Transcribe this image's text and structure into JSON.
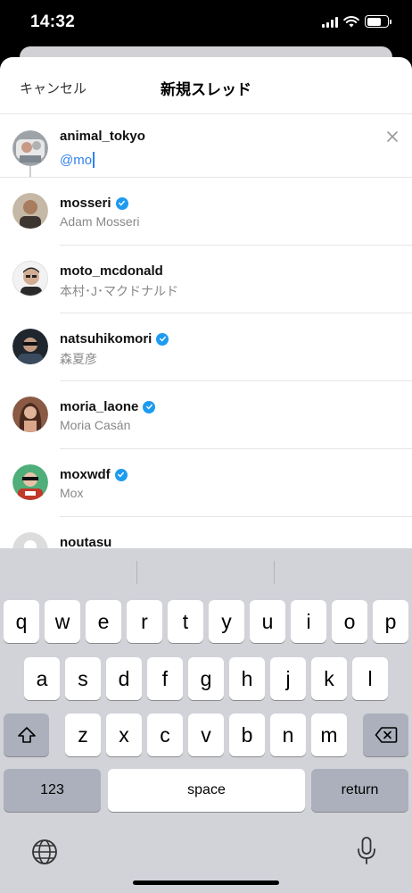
{
  "status_bar": {
    "time": "14:32"
  },
  "header": {
    "cancel_label": "キャンセル",
    "title": "新規スレッド"
  },
  "compose": {
    "username": "animal_tokyo",
    "input_text": "@mo"
  },
  "results": [
    {
      "username": "mosseri",
      "full_name": "Adam Mosseri",
      "verified": true,
      "avatar_color": "#6b5a4a"
    },
    {
      "username": "moto_mcdonald",
      "full_name": "本村･J･マクドナルド",
      "verified": false,
      "avatar_color": "#4a4a4a"
    },
    {
      "username": "natsuhikomori",
      "full_name": "森夏彦",
      "verified": true,
      "avatar_color": "#222a33"
    },
    {
      "username": "moria_laone",
      "full_name": "Moria Casán",
      "verified": true,
      "avatar_color": "#7a4a36"
    },
    {
      "username": "moxwdf",
      "full_name": "Mox",
      "verified": true,
      "avatar_color": "#3a9b6a"
    },
    {
      "username": "noutasu",
      "full_name": "",
      "verified": false,
      "avatar_color": "#dcdcdc"
    }
  ],
  "keyboard": {
    "row1": [
      "q",
      "w",
      "e",
      "r",
      "t",
      "y",
      "u",
      "i",
      "o",
      "p"
    ],
    "row2": [
      "a",
      "s",
      "d",
      "f",
      "g",
      "h",
      "j",
      "k",
      "l"
    ],
    "row3": [
      "z",
      "x",
      "c",
      "v",
      "b",
      "n",
      "m"
    ],
    "numbers_label": "123",
    "space_label": "space",
    "return_label": "return"
  },
  "colors": {
    "accent": "#2f80ed",
    "verified": "#1d9bf0"
  }
}
